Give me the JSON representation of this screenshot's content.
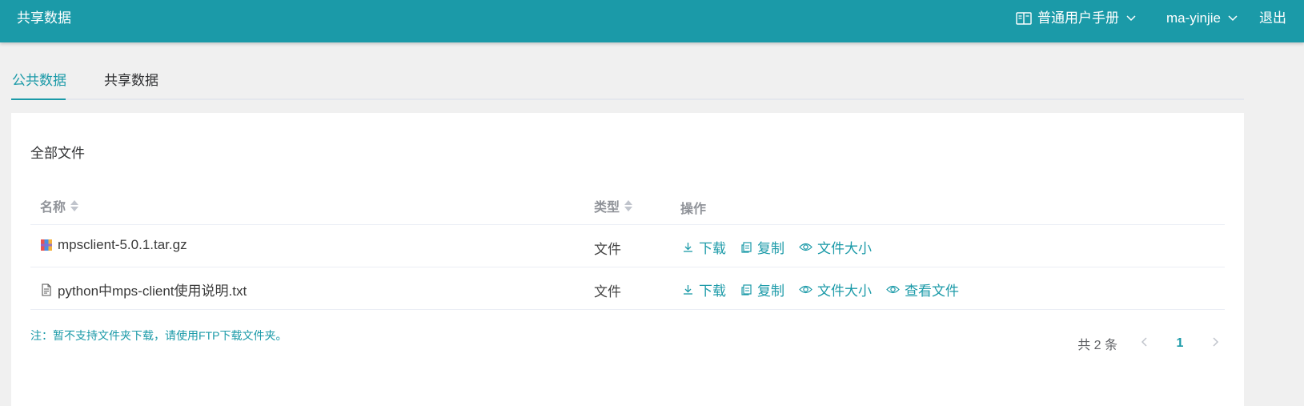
{
  "header": {
    "title": "共享数据",
    "manual_label": "普通用户手册",
    "username": "ma-yinjie",
    "logout_label": "退出"
  },
  "tabs": [
    {
      "label": "公共数据",
      "active": true
    },
    {
      "label": "共享数据",
      "active": false
    }
  ],
  "panel": {
    "section_title": "全部文件",
    "columns": {
      "name": "名称",
      "type": "类型",
      "ops": "操作"
    },
    "rows": [
      {
        "name": "mpsclient-5.0.1.tar.gz",
        "icon": "archive-icon",
        "type": "文件",
        "ops": [
          "下载",
          "复制",
          "文件大小"
        ]
      },
      {
        "name": "python中mps-client使用说明.txt",
        "icon": "text-file-icon",
        "type": "文件",
        "ops": [
          "下载",
          "复制",
          "文件大小",
          "查看文件"
        ]
      }
    ],
    "note": "注：暂不支持文件夹下载，请使用FTP下载文件夹。",
    "pagination": {
      "total_label": "共 2 条",
      "current_page": "1"
    }
  },
  "colors": {
    "accent": "#1b9aa8"
  }
}
